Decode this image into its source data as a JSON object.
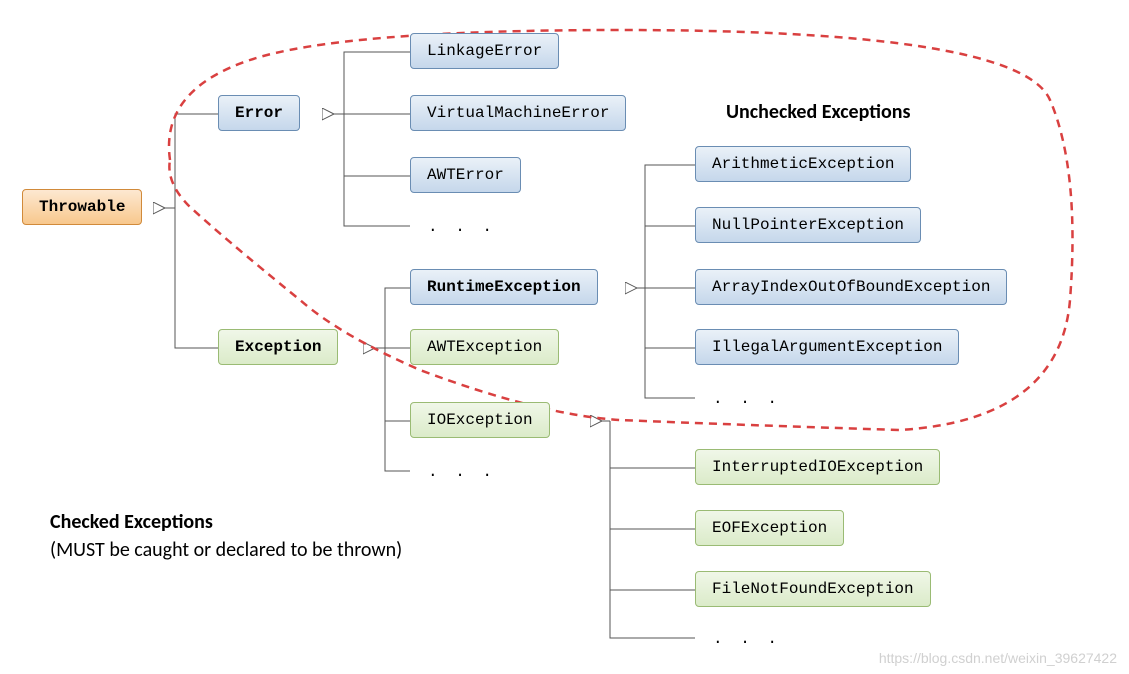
{
  "root": {
    "name": "Throwable"
  },
  "error": {
    "name": "Error",
    "children": [
      "LinkageError",
      "VirtualMachineError",
      "AWTError"
    ],
    "ellipsis": ". . ."
  },
  "exception": {
    "name": "Exception",
    "runtime": {
      "name": "RuntimeException",
      "children": [
        "ArithmeticException",
        "NullPointerException",
        "ArrayIndexOutOfBoundException",
        "IllegalArgumentException"
      ],
      "ellipsis": ". . ."
    },
    "checked_items": [
      "AWTException",
      "IOException"
    ],
    "ellipsis": ". . .",
    "io_children": [
      "InterruptedIOException",
      "EOFException",
      "FileNotFoundException"
    ],
    "io_ellipsis": ". . ."
  },
  "labels": {
    "unchecked": "Unchecked Exceptions",
    "checked_title": "Checked Exceptions",
    "checked_note": "(MUST be caught or declared to be thrown)"
  },
  "watermark": "https://blog.csdn.net/weixin_39627422"
}
